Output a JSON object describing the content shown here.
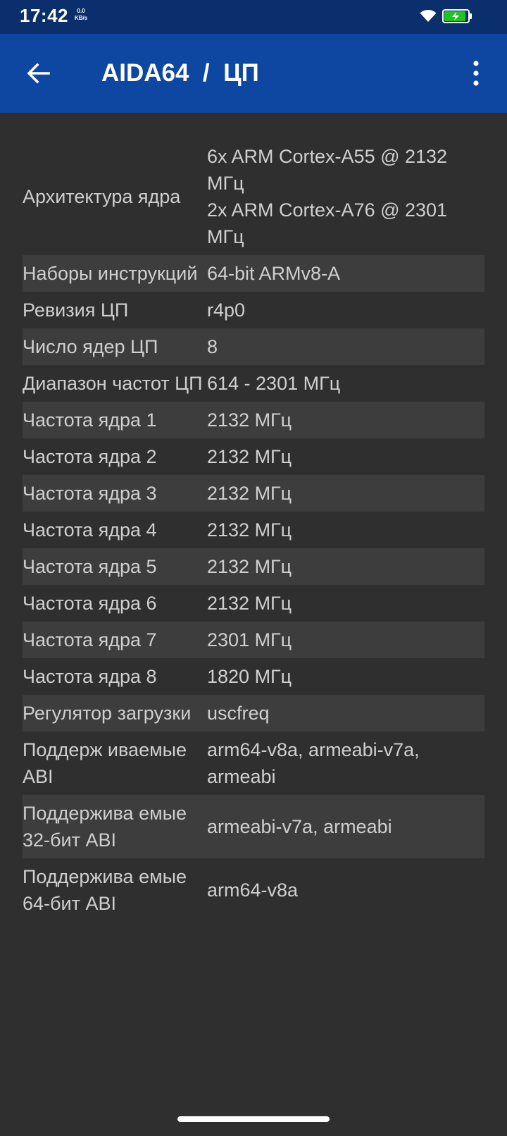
{
  "status_bar": {
    "time": "17:42",
    "net_speed_value": "0.0",
    "net_speed_unit": "KB/s",
    "icons": [
      "wifi-icon",
      "battery-charging-icon"
    ],
    "battery_fill_color": "#21c521"
  },
  "app_bar": {
    "title": "AIDA64  /  ЦП",
    "back_icon": "arrow-left-icon",
    "menu_icon": "more-vert-icon",
    "background_color": "#0d47a1"
  },
  "rows": [
    {
      "label": "Архитектура ядра",
      "value": "6x ARM Cortex-A55 @ 2132 МГц\n2x ARM Cortex-A76 @ 2301 МГц"
    },
    {
      "label": "Наборы инструкций",
      "value": "64-bit ARMv8-A"
    },
    {
      "label": "Ревизия ЦП",
      "value": "r4p0"
    },
    {
      "label": "Число ядер ЦП",
      "value": "8"
    },
    {
      "label": "Диапазон частот ЦП",
      "value": "614 - 2301 МГц"
    },
    {
      "label": "Частота ядра 1",
      "value": "2132 МГц"
    },
    {
      "label": "Частота ядра 2",
      "value": "2132 МГц"
    },
    {
      "label": "Частота ядра 3",
      "value": "2132 МГц"
    },
    {
      "label": "Частота ядра 4",
      "value": "2132 МГц"
    },
    {
      "label": "Частота ядра 5",
      "value": "2132 МГц"
    },
    {
      "label": "Частота ядра 6",
      "value": "2132 МГц"
    },
    {
      "label": "Частота ядра 7",
      "value": "2301 МГц"
    },
    {
      "label": "Частота ядра 8",
      "value": "1820 МГц"
    },
    {
      "label": "Регулятор загрузки",
      "value": "uscfreq"
    },
    {
      "label": "Поддерж иваемые ABI",
      "value": "arm64-v8a, armeabi-v7a, armeabi"
    },
    {
      "label": "Поддержива емые 32-бит ABI",
      "value": "armeabi-v7a, armeabi"
    },
    {
      "label": "Поддержива емые 64-бит ABI",
      "value": "arm64-v8a"
    }
  ]
}
